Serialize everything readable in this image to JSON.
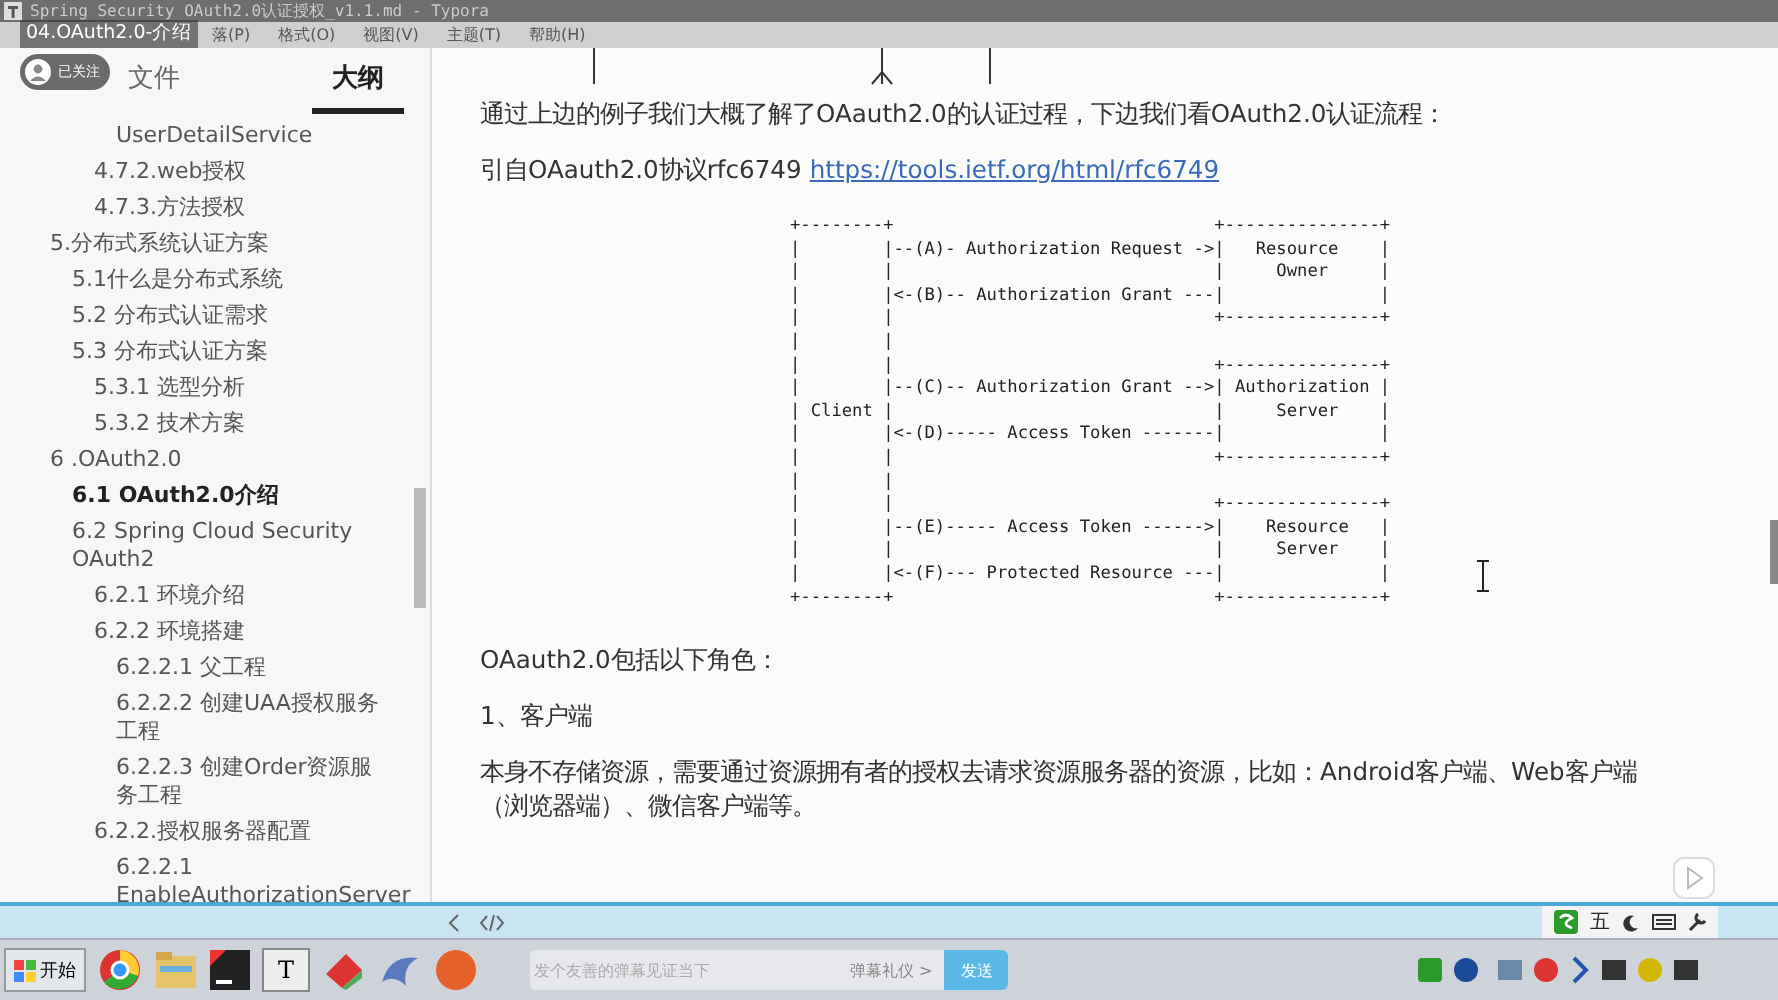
{
  "window": {
    "title": "Spring Security OAuth2.0认证授权_v1.1.md - Typora"
  },
  "video_title": "04.OAuth2.0-介绍",
  "follow_badge": "已关注",
  "menu": [
    "落(P)",
    "格式(O)",
    "视图(V)",
    "主题(T)",
    "帮助(H)"
  ],
  "sidebar": {
    "tabs": [
      {
        "label": "文件",
        "selected": false
      },
      {
        "label": "大纲",
        "selected": true
      }
    ],
    "outline": [
      {
        "children": [
          {
            "children": [
              {
                "children": [
                  {
                    "label": "UserDetailService",
                    "selected": false
                  }
                ]
              },
              {
                "label": "4.7.2.web授权",
                "selected": false
              },
              {
                "label": "4.7.3.方法授权",
                "selected": false
              }
            ]
          }
        ]
      },
      {
        "label": "5.分布式系统认证方案",
        "selected": false,
        "children": [
          {
            "label": "5.1什么是分布式系统",
            "selected": false
          },
          {
            "label": "5.2 分布式认证需求",
            "selected": false
          },
          {
            "label": "5.3 分布式认证方案",
            "selected": false,
            "children": [
              {
                "label": "5.3.1 选型分析",
                "selected": false
              },
              {
                "label": "5.3.2 技术方案",
                "selected": false
              }
            ]
          }
        ]
      },
      {
        "label": "6 .OAuth2.0",
        "selected": false,
        "children": [
          {
            "label": "6.1 OAuth2.0介绍",
            "selected": true
          },
          {
            "label": "6.2 Spring Cloud Security OAuth2",
            "selected": false,
            "children": [
              {
                "label": "6.2.1 环境介绍",
                "selected": false
              },
              {
                "label": "6.2.2 环境搭建",
                "selected": false,
                "children": [
                  {
                    "label": "6.2.2.1 父工程",
                    "selected": false
                  },
                  {
                    "label": "6.2.2.2 创建UAA授权服务工程",
                    "selected": false
                  },
                  {
                    "label": "6.2.2.3 创建Order资源服务工程",
                    "selected": false
                  }
                ]
              },
              {
                "label": "6.2.2.授权服务器配置",
                "selected": false,
                "children": [
                  {
                    "label": "6.2.2.1 EnableAuthorizationServer",
                    "selected": false
                  }
                ]
              }
            ]
          }
        ]
      }
    ]
  },
  "content": [
    {
      "kind": "para",
      "text": "通过上边的例子我们大概了解了OAauth2.0的认证过程，下边我们看OAuth2.0认证流程："
    },
    {
      "kind": "para",
      "text": "引自OAauth2.0协议rfc6749",
      "link": "https://tools.ietf.org/html/rfc6749"
    },
    {
      "kind": "diagram",
      "lines": [
        "+--------+                               +---------------+",
        "|        |--(A)- Authorization Request ->|   Resource    |",
        "|        |                               |     Owner     |",
        "|        |<-(B)-- Authorization Grant ---|               |",
        "|        |                               +---------------+",
        "|        |",
        "|        |                               +---------------+",
        "|        |--(C)-- Authorization Grant -->| Authorization |",
        "| Client |                               |     Server    |",
        "|        |<-(D)----- Access Token -------|               |",
        "|        |                               +---------------+",
        "|        |",
        "|        |                               +---------------+",
        "|        |--(E)----- Access Token ------>|    Resource   |",
        "|        |                               |     Server    |",
        "|        |<-(F)--- Protected Resource ---|               |",
        "+--------+                               +---------------+"
      ]
    },
    {
      "kind": "para",
      "text": "OAauth2.0包括以下角色："
    },
    {
      "kind": "para",
      "text": "1、客户端"
    },
    {
      "kind": "para",
      "text": "本身不存储资源，需要通过资源拥有者的授权去请求资源服务器的资源，比如：Android客户端、Web客户端（浏览器端）、微信客户端等。"
    }
  ],
  "ime": {
    "label": "五"
  },
  "taskbar": {
    "start": "开始",
    "app_letter": "T",
    "danmaku_placeholder": "发个友善的弹幕见证当下",
    "etiquette": "弹幕礼仪 >",
    "send": "发送"
  }
}
